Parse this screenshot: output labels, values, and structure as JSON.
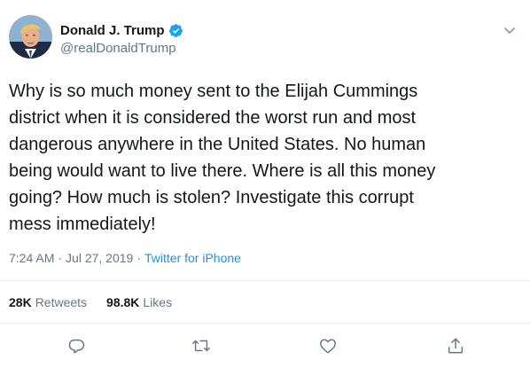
{
  "author": {
    "display_name": "Donald J. Trump",
    "handle": "@realDonaldTrump",
    "verified": true,
    "verified_color": "#1da1f2"
  },
  "tweet": {
    "text": "Why is so much money sent to the Elijah Cummings\ndistrict when it is considered the worst run and most\ndangerous anywhere in the United States. No human\nbeing would want to live there. Where is all this money\ngoing? How much is stolen? Investigate this corrupt\nmess immediately!",
    "time": "7:24 AM",
    "separator_1": "·",
    "date": "Jul 27, 2019",
    "separator_2": "·",
    "source": "Twitter for iPhone"
  },
  "stats": {
    "retweets_count": "28K",
    "retweets_label": "Retweets",
    "likes_count": "98.8K",
    "likes_label": "Likes"
  },
  "icons": {
    "menu": "chevron-down-icon",
    "reply": "reply-icon",
    "retweet": "retweet-icon",
    "like": "heart-icon",
    "share": "share-icon"
  },
  "colors": {
    "text": "#14171a",
    "secondary": "#657786",
    "link": "#1b95e0",
    "divider": "#e6ecf0"
  }
}
